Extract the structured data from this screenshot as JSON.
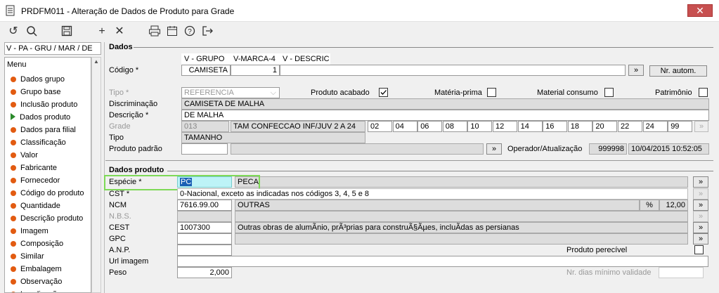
{
  "window": {
    "title": "PRDFM011 - Alteração de Dados de Produto para Grade",
    "close_label": "✕"
  },
  "toolbar": {
    "icons": [
      "undo-icon",
      "search-icon",
      "save-icon",
      "add-icon",
      "delete-icon",
      "print-icon",
      "calendar-icon",
      "help-icon",
      "exit-icon"
    ]
  },
  "left_select": {
    "value": "V - PA - GRU / MAR / DE"
  },
  "menu": {
    "title": "Menu",
    "items": [
      "Dados grupo",
      "Grupo base",
      "Inclusão produto",
      "Dados produto",
      "Dados para filial",
      "Classificação",
      "Valor",
      "Fabricante",
      "Fornecedor",
      "Código do produto",
      "Quantidade",
      "Descrição produto",
      "Imagem",
      "Composição",
      "Similar",
      "Embalagem",
      "Observação",
      "Localização"
    ],
    "active_index": 3
  },
  "dados": {
    "section_title": "Dados",
    "codigo_label": "Código *",
    "col_headers": [
      "V - GRUPO",
      "V-MARCA-4",
      "V - DESCRIC"
    ],
    "codigo_values": [
      "CAMISETA",
      "1",
      ""
    ],
    "nr_autom_label": "Nr. autom.",
    "tipo_label": "Tipo *",
    "tipo_value": "REFERENCIA",
    "produto_acabado_label": "Produto acabado",
    "produto_acabado_checked": true,
    "materia_prima_label": "Matéria-prima",
    "material_consumo_label": "Material consumo",
    "patrimonio_label": "Patrimônio",
    "discriminacao_label": "Discriminação",
    "discriminacao_value": "CAMISETA DE MALHA",
    "descricao_label": "Descrição *",
    "descricao_value": "DE MALHA",
    "grade_label": "Grade",
    "grade_code": "013",
    "grade_desc": "TAM CONFECCAO INF/JUV 2 A 24",
    "grade_sizes": [
      "02",
      "04",
      "06",
      "08",
      "10",
      "12",
      "14",
      "16",
      "18",
      "20",
      "22",
      "24",
      "99"
    ],
    "tipo2_label": "Tipo",
    "tipo2_value": "TAMANHO",
    "produto_padrao_label": "Produto padrão",
    "produto_padrao_value": "",
    "operador_label": "Operador/Atualização",
    "operador_value": "999998",
    "atualizacao_value": "10/04/2015 10:52:05"
  },
  "dados_produto": {
    "section_title": "Dados produto",
    "especie_label": "Espécie *",
    "especie_code": "PC",
    "especie_desc": "PECA",
    "cst_label": "CST *",
    "cst_value": "0-Nacional, exceto as indicadas nos códigos 3, 4, 5 e 8",
    "ncm_label": "NCM",
    "ncm_code": "7616.99.00",
    "ncm_desc": "OUTRAS",
    "ncm_pct_label": "%",
    "ncm_pct": "12,00",
    "nbs_label": "N.B.S.",
    "cest_label": "CEST",
    "cest_code": "1007300",
    "cest_desc": "Outras obras de alumÃ­nio, prÃ³prias para construÃ§Ãµes, incluÃ­das as persianas",
    "gpc_label": "GPC",
    "anp_label": "A.N.P.",
    "perecivel_label": "Produto perecível",
    "url_label": "Url imagem",
    "peso_label": "Peso",
    "peso_value": "2,000",
    "validade_label": "Nr. dias mínimo validade"
  },
  "colors": {
    "accent_green": "#7ed957",
    "close_red": "#c75050",
    "menu_dot": "#e25b11",
    "selection_cyan": "#bdf3f7"
  }
}
